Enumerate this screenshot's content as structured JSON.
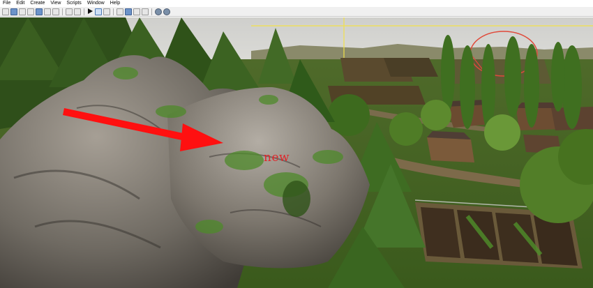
{
  "menu": [
    "File",
    "Edit",
    "Create",
    "View",
    "Scripts",
    "Window",
    "Help"
  ],
  "toolbar_icons": [
    "new-file-icon",
    "open-folder-icon",
    "save-icon",
    "save-as-icon",
    "print-icon",
    "cut-icon",
    "play-icon",
    "select-icon",
    "move-icon",
    "rotate-icon",
    "scale-icon",
    "terrain-icon",
    "paint-icon",
    "settings-gear-icon",
    "help-icon"
  ],
  "annotation": {
    "text": "new",
    "color": "#e0262a"
  },
  "colors": {
    "sky": "#d4d4d2",
    "arrow": "#ff1010",
    "guide_line": "#f2e14a"
  }
}
